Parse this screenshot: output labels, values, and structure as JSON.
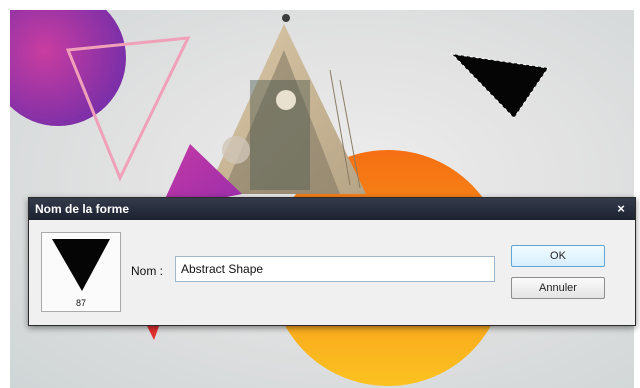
{
  "dialog": {
    "title": "Nom de la forme",
    "close_glyph": "×",
    "preview": {
      "shape_icon": "inverted-triangle-icon",
      "number": "87"
    },
    "name_label": "Nom :",
    "name_value": "Abstract Shape",
    "ok_label": "OK",
    "cancel_label": "Annuler"
  },
  "colors": {
    "titlebar": "#1c2230",
    "ok_border": "#5fa6d6",
    "orange_circle": "#f48a1c",
    "purple_circle": "#b22ca8"
  }
}
